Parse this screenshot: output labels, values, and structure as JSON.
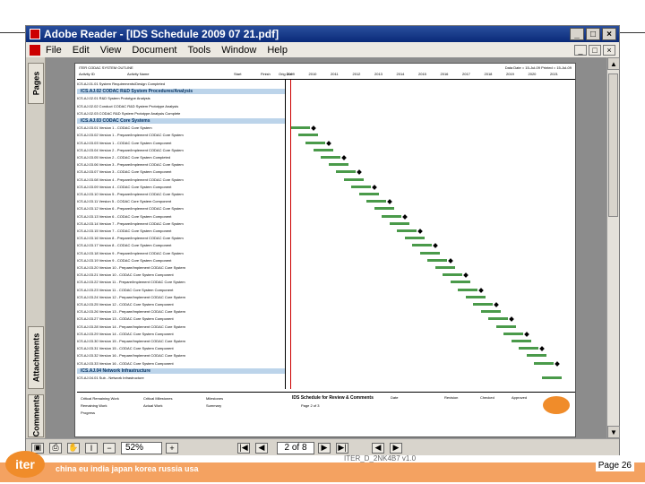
{
  "window": {
    "title": "Adobe Reader - [IDS Schedule 2009 07 21.pdf]",
    "window_buttons": [
      "_",
      "□",
      "×"
    ]
  },
  "menu": {
    "items": [
      "File",
      "Edit",
      "View",
      "Document",
      "Tools",
      "Window",
      "Help"
    ],
    "doc_buttons": [
      "_",
      "□",
      "×"
    ]
  },
  "sidebar": {
    "tabs": [
      "Pages",
      "Attachments",
      "Comments"
    ]
  },
  "statusbar": {
    "zoom": "52%",
    "page": "2 of 8"
  },
  "gantt": {
    "header": {
      "left": "ITER CODAC SYSTEM OUTLINE",
      "cols": [
        "Activity ID",
        "Activity Name",
        "Start",
        "Finish",
        "Orig Dur"
      ],
      "right": "Data Date = 15-Jul-09  Printed = 15-Jul-09",
      "years": [
        "2009",
        "2010",
        "2011",
        "2012",
        "2013",
        "2014",
        "2015",
        "2016",
        "2017",
        "2018",
        "2019",
        "2020",
        "2021"
      ]
    },
    "sections": [
      "ICS.AJ.02  CODAC R&D System Procedures/Analysis",
      "ICS.AJ.03  CODAC Core Systems",
      "ICS.AJ.04  Network Infrastructure"
    ],
    "rows": [
      "ICS.AJ.01.01 System Requirements/Design Completed",
      "ICS.AJ.02.01 R&D System Prototype Analysis",
      "ICS.AJ.02.02 Conduct CODAC R&D System Prototype Analysis",
      "ICS.AJ.02.03 CODAC R&D System Prototype Analysis Complete",
      "ICS.AJ.03.01 Version 1 - CODAC Core System",
      "ICS.AJ.03.02 Version 1 - Prepare/Implement CODAC Core System",
      "ICS.AJ.03.03 Version 1 - CODAC Core System Component",
      "ICS.AJ.03.04 Version 2 - Prepare/Implement CODAC Core System",
      "ICS.AJ.03.05 Version 2 - CODAC Core System Completed",
      "ICS.AJ.03.06 Version 3 - Prepare/Implement CODAC Core System",
      "ICS.AJ.03.07 Version 3 - CODAC Core System Component",
      "ICS.AJ.03.08 Version 4 - Prepare/Implement CODAC Core System",
      "ICS.AJ.03.09 Version 4 - CODAC Core System Component",
      "ICS.AJ.03.10 Version 5 - Prepare/Implement CODAC Core System",
      "ICS.AJ.03.11 Version 5 - CODAC Core System Component",
      "ICS.AJ.03.12 Version 6 - Prepare/Implement CODAC Core System",
      "ICS.AJ.03.13 Version 6 - CODAC Core System Component",
      "ICS.AJ.03.14 Version 7 - Prepare/Implement CODAC Core System",
      "ICS.AJ.03.15 Version 7 - CODAC Core System Component",
      "ICS.AJ.03.16 Version 8 - Prepare/Implement CODAC Core System",
      "ICS.AJ.03.17 Version 8 - CODAC Core System Component",
      "ICS.AJ.03.18 Version 9 - Prepare/Implement CODAC Core System",
      "ICS.AJ.03.19 Version 9 - CODAC Core System Component",
      "ICS.AJ.03.20 Version 10 - Prepare/Implement CODAC Core System",
      "ICS.AJ.03.21 Version 10 - CODAC Core System Component",
      "ICS.AJ.03.22 Version 11 - Prepare/Implement CODAC Core System",
      "ICS.AJ.03.23 Version 11 - CODAC Core System Component",
      "ICS.AJ.03.24 Version 12 - Prepare/Implement CODAC Core System",
      "ICS.AJ.03.25 Version 12 - CODAC Core System Component",
      "ICS.AJ.03.26 Version 13 - Prepare/Implement CODAC Core System",
      "ICS.AJ.03.27 Version 13 - CODAC Core System Component",
      "ICS.AJ.03.28 Version 14 - Prepare/Implement CODAC Core System",
      "ICS.AJ.03.29 Version 14 - CODAC Core System Component",
      "ICS.AJ.03.30 Version 15 - Prepare/Implement CODAC Core System",
      "ICS.AJ.03.31 Version 15 - CODAC Core System Component",
      "ICS.AJ.03.32 Version 16 - Prepare/Implement CODAC Core System",
      "ICS.AJ.03.33 Version 16 - CODAC Core System Component",
      "ICS.AJ.04.01 Sub - Network Infrastructure"
    ],
    "legend": {
      "items": [
        "Critical Remaining Work",
        "Critical Milestones",
        "Milestones",
        "Remaining Work",
        "Actual Work",
        "Summary",
        "Progress"
      ],
      "title": "IDS Schedule for Review & Comments",
      "page": "Page 2 of 3",
      "cols": [
        "Date",
        "Revision",
        "Checked",
        "Approved"
      ]
    }
  },
  "footer": {
    "logo": "iter",
    "countries": "china eu india japan korea russia usa",
    "doc_id": "ITER_D_2NK4B7 v1.0",
    "page": "Page 26"
  },
  "colors": {
    "title_bar": "#0a2a78",
    "footer_bar": "#f4a261",
    "logo": "#f08c2a",
    "section_fill": "#bcd4ea",
    "bar_green": "#4a9a4a",
    "data_date_line": "#cc0000"
  }
}
